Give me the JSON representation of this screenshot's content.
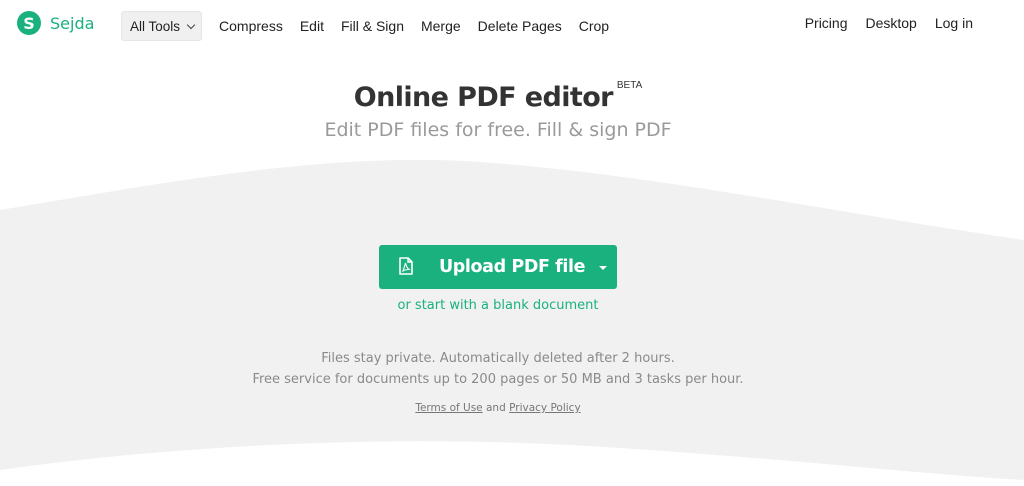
{
  "header": {
    "logo_text": "Sejda",
    "logo_letter": "S",
    "all_tools_label": "All Tools",
    "nav_links": [
      "Compress",
      "Edit",
      "Fill & Sign",
      "Merge",
      "Delete Pages",
      "Crop"
    ],
    "right_links": [
      "Pricing",
      "Desktop",
      "Log in"
    ]
  },
  "hero": {
    "title": "Online PDF editor",
    "title_badge": "BETA",
    "subtitle": "Edit PDF files for free. Fill & sign PDF"
  },
  "upload": {
    "button_label": "Upload PDF file",
    "blank_document_link": "or start with a blank document"
  },
  "info": {
    "line1": "Files stay private. Automatically deleted after 2 hours.",
    "line2": "Free service for documents up to 200 pages or 50 MB and 3 tasks per hour."
  },
  "legal": {
    "terms_label": "Terms of Use",
    "and_label": "and",
    "privacy_label": "Privacy Policy"
  },
  "colors": {
    "brand_green": "#1ab17e",
    "band_gray": "#f1f1f1"
  },
  "icons": {
    "logo": "sejda-logo-icon",
    "dropdown": "chevron-down-icon",
    "pdf_file": "pdf-file-icon",
    "caret": "caret-down-icon"
  }
}
